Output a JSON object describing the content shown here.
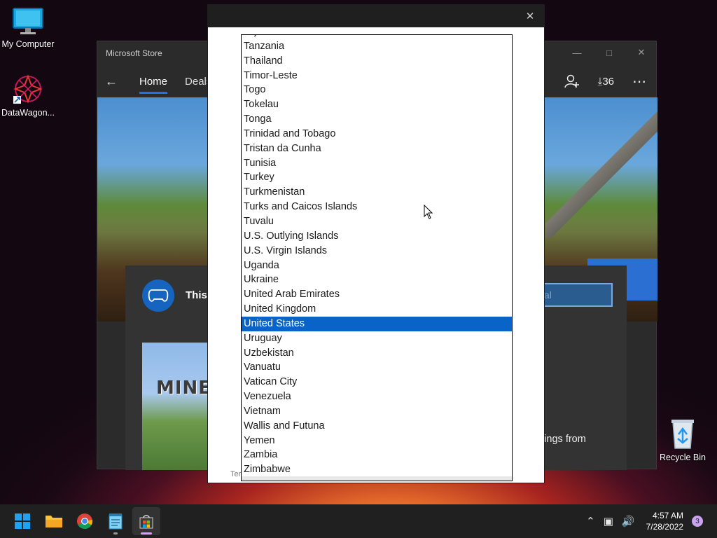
{
  "desktop": {
    "icons": [
      {
        "label": "My Computer"
      },
      {
        "label": "DataWagon..."
      },
      {
        "label": "Recycle Bin"
      }
    ]
  },
  "store": {
    "title": "Microsoft Store",
    "nav": {
      "home": "Home",
      "deals": "Deals",
      "downloads_count": "36",
      "more": "⋯"
    },
    "promo": {
      "text_fragment": "This",
      "button_fragment": "al",
      "description_fragment": "g things from",
      "logo_fragment": "MINE"
    }
  },
  "dialog": {
    "close_glyph": "✕",
    "terms_fragment": "Ter"
  },
  "country_list": {
    "items": [
      "Tajikistan",
      "Tanzania",
      "Thailand",
      "Timor-Leste",
      "Togo",
      "Tokelau",
      "Tonga",
      "Trinidad and Tobago",
      "Tristan da Cunha",
      "Tunisia",
      "Turkey",
      "Turkmenistan",
      "Turks and Caicos Islands",
      "Tuvalu",
      "U.S. Outlying Islands",
      "U.S. Virgin Islands",
      "Uganda",
      "Ukraine",
      "United Arab Emirates",
      "United Kingdom",
      "United States",
      "Uruguay",
      "Uzbekistan",
      "Vanuatu",
      "Vatican City",
      "Venezuela",
      "Vietnam",
      "Wallis and Futuna",
      "Yemen",
      "Zambia",
      "Zimbabwe"
    ],
    "selected": "United States"
  },
  "taskbar": {
    "apps": [
      "start",
      "file-explorer",
      "chrome",
      "notepad",
      "microsoft-store"
    ],
    "active_app": "microsoft-store",
    "time": "4:57 AM",
    "date": "7/28/2022",
    "notification_count": "3"
  },
  "colors": {
    "selection": "#0a64c8",
    "store_accent": "#1a73e8",
    "taskbar": "#202020"
  }
}
